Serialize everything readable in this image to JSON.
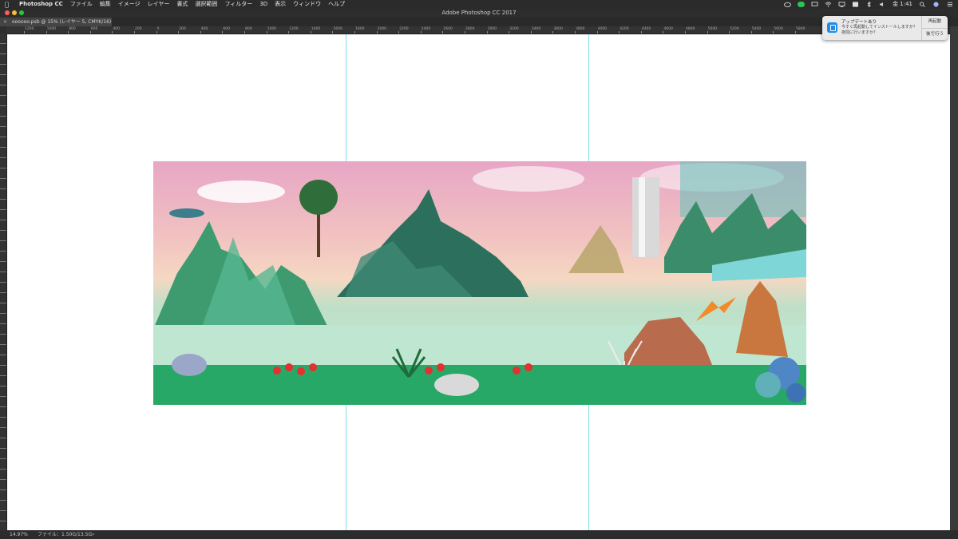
{
  "menubar": {
    "app_name": "Photoshop CC",
    "items": [
      "ファイル",
      "編集",
      "イメージ",
      "レイヤー",
      "書式",
      "選択範囲",
      "フィルター",
      "3D",
      "表示",
      "ウィンドウ",
      "ヘルプ"
    ],
    "clock": "金 1:41"
  },
  "window": {
    "title": "Adobe Photoshop CC 2017"
  },
  "document_tab": {
    "label": "oooooo.psb @ 15% (レイヤー 5, CMYK/16) *"
  },
  "ruler": {
    "ticks": [
      "1200",
      "1000",
      "800",
      "600",
      "400",
      "200",
      "0",
      "200",
      "400",
      "600",
      "800",
      "1000",
      "1200",
      "1400",
      "1600",
      "1800",
      "2000",
      "2200",
      "2400",
      "2600",
      "2800",
      "3000",
      "3200",
      "3400",
      "3600",
      "3800",
      "4000",
      "4200",
      "4400",
      "4600",
      "4800",
      "5000",
      "5200",
      "5400",
      "5600",
      "5800"
    ]
  },
  "notification": {
    "title": "アップデートあり",
    "body": "今すぐ再起動してインストールしますか？ 夜間に行いますか？",
    "restart_label": "再起動",
    "later_label": "後で行う"
  },
  "statusbar": {
    "zoom": "14.97%",
    "file_info": "ファイル：1.50G/13.5G",
    "arrow": ">"
  },
  "colors": {
    "accent_guide": "#7fe3ec",
    "notification_icon": "#1d8ce8"
  }
}
